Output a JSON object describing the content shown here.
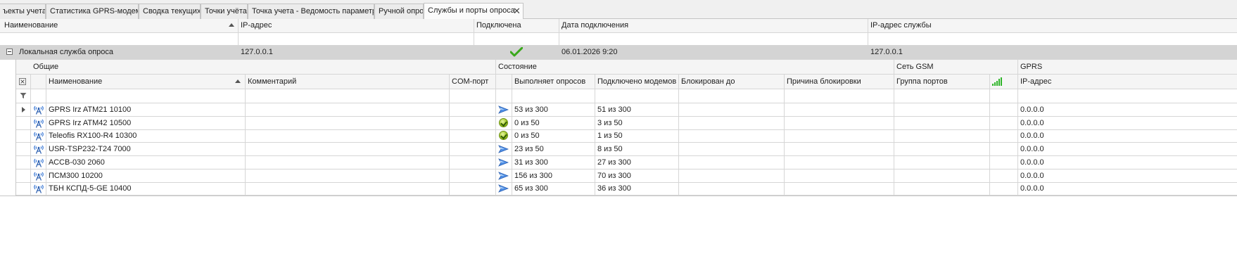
{
  "tabs": [
    {
      "label": "ъекты учета"
    },
    {
      "label": "Статистика GPRS-модемов"
    },
    {
      "label": "Сводка текущих"
    },
    {
      "label": "Точки учёта"
    },
    {
      "label": "Точка учета - Ведомость параметров"
    },
    {
      "label": "Ручной опрос"
    },
    {
      "label": "Службы и порты опроса",
      "active": true,
      "close": "✕"
    }
  ],
  "master": {
    "columns": {
      "name": "Наименование",
      "ip": "IP-адрес",
      "connected": "Подключена",
      "date": "Дата подключения",
      "service_ip": "IP-адрес службы"
    },
    "row": {
      "expander": "⊟",
      "name": "Локальная служба опроса",
      "ip": "127.0.0.1",
      "connected": true,
      "date": "06.01.2026 9:20",
      "service_ip": "127.0.0.1"
    }
  },
  "detail": {
    "bands": {
      "general": "Общие",
      "state": "Состояние",
      "gsm": "Сеть GSM",
      "gprs": "GPRS"
    },
    "columns": {
      "name": "Наименование",
      "comment": "Комментарий",
      "com_port": "COM-порт",
      "polling": "Выполняет опросов",
      "modems": "Подключено модемов",
      "blocked_until": "Блокирован до",
      "block_reason": "Причина блокировки",
      "port_group": "Группа портов",
      "ip": "IP-адрес"
    },
    "rows": [
      {
        "name": "GPRS Irz ATM21 10100",
        "status": "play",
        "polling": "53 из 300",
        "modems": "51 из 300",
        "ip": "0.0.0.0",
        "focused": true
      },
      {
        "name": "GPRS Irz ATM42 10500",
        "status": "ok",
        "polling": "0 из 50",
        "modems": "3 из 50",
        "ip": "0.0.0.0"
      },
      {
        "name": "Teleofis RX100-R4 10300",
        "status": "ok",
        "polling": "0 из 50",
        "modems": "1 из 50",
        "ip": "0.0.0.0"
      },
      {
        "name": "USR-TSP232-T24 7000",
        "status": "play",
        "polling": "23 из 50",
        "modems": "8 из 50",
        "ip": "0.0.0.0"
      },
      {
        "name": "АССВ-030 2060",
        "status": "play",
        "polling": "31 из 300",
        "modems": "27 из 300",
        "ip": "0.0.0.0"
      },
      {
        "name": "ПСМ300 10200",
        "status": "play",
        "polling": "156 из 300",
        "modems": "70 из 300",
        "ip": "0.0.0.0"
      },
      {
        "name": "ТБН КСПД-5-GE 10400",
        "status": "play",
        "polling": "65 из 300",
        "modems": "36 из 300",
        "ip": "0.0.0.0"
      }
    ]
  },
  "colors": {
    "accent_green": "#3aa81b",
    "selected_row": "#d4d4d4",
    "play_blue": "#3e7bd6",
    "signal_green": "#2fb52a"
  }
}
